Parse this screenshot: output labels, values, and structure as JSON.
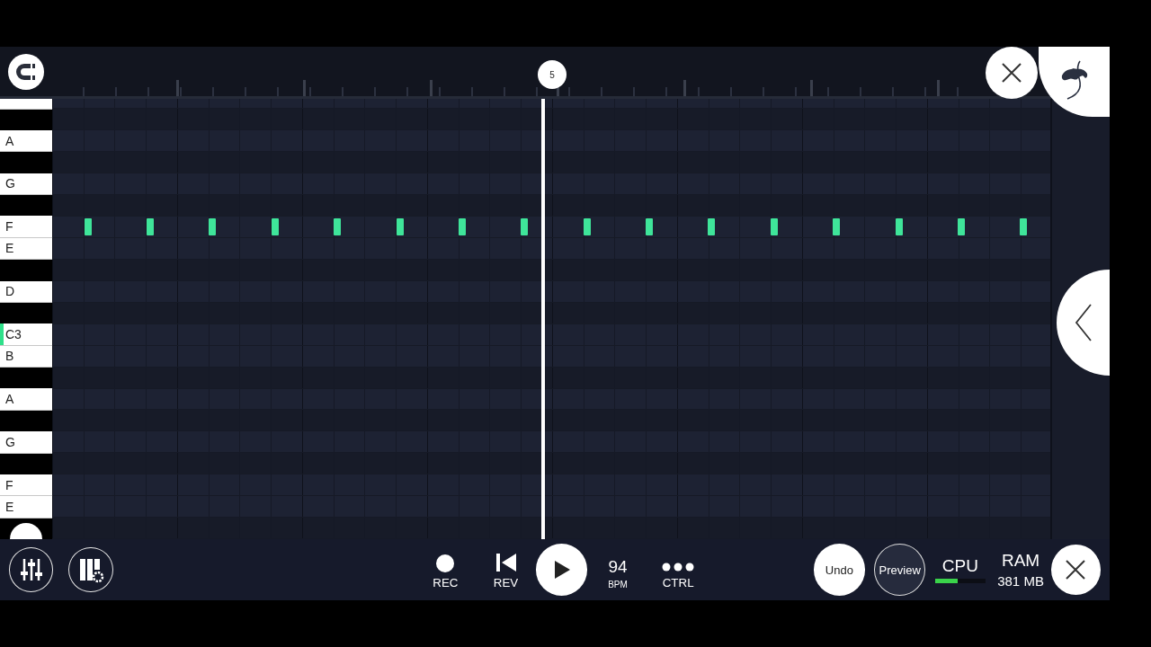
{
  "ruler": {
    "bar_marker": "5"
  },
  "playhead": {
    "level": 0.49
  },
  "keys": [
    {
      "kind": "white",
      "active": false
    },
    {
      "kind": "black",
      "active": false
    },
    {
      "kind": "white",
      "label": "A",
      "active": false
    },
    {
      "kind": "black",
      "active": false
    },
    {
      "kind": "white",
      "label": "G",
      "active": false
    },
    {
      "kind": "black",
      "active": false
    },
    {
      "kind": "white",
      "label": "F",
      "active": false,
      "steps": [
        false,
        true,
        false,
        true,
        false,
        true,
        false,
        true,
        false,
        true,
        false,
        true,
        false,
        true,
        false,
        true,
        false,
        true,
        false,
        true,
        false,
        true,
        false,
        true,
        false,
        true,
        false,
        true,
        false,
        true,
        false,
        true
      ]
    },
    {
      "kind": "white",
      "label": "E",
      "active": false
    },
    {
      "kind": "black",
      "active": false
    },
    {
      "kind": "white",
      "label": "D",
      "active": false
    },
    {
      "kind": "black",
      "active": false
    },
    {
      "kind": "white",
      "label": "C3",
      "active": true
    },
    {
      "kind": "white",
      "label": "B",
      "active": false
    },
    {
      "kind": "black",
      "active": false
    },
    {
      "kind": "white",
      "label": "A",
      "active": false
    },
    {
      "kind": "black",
      "active": false
    },
    {
      "kind": "white",
      "label": "G",
      "active": false
    },
    {
      "kind": "black",
      "active": false
    },
    {
      "kind": "white",
      "label": "F",
      "active": false
    },
    {
      "kind": "white",
      "label": "E",
      "active": false
    },
    {
      "kind": "black",
      "active": false
    }
  ],
  "transport": {
    "rec": "REC",
    "rev": "REV",
    "bpm": "94",
    "bpm_label": "BPM",
    "ctrl": "CTRL"
  },
  "buttons": {
    "undo": "Undo",
    "preview": "Preview"
  },
  "cpu": {
    "label": "CPU",
    "level": 0.45
  },
  "ram": {
    "label": "RAM",
    "value": "381 MB"
  }
}
